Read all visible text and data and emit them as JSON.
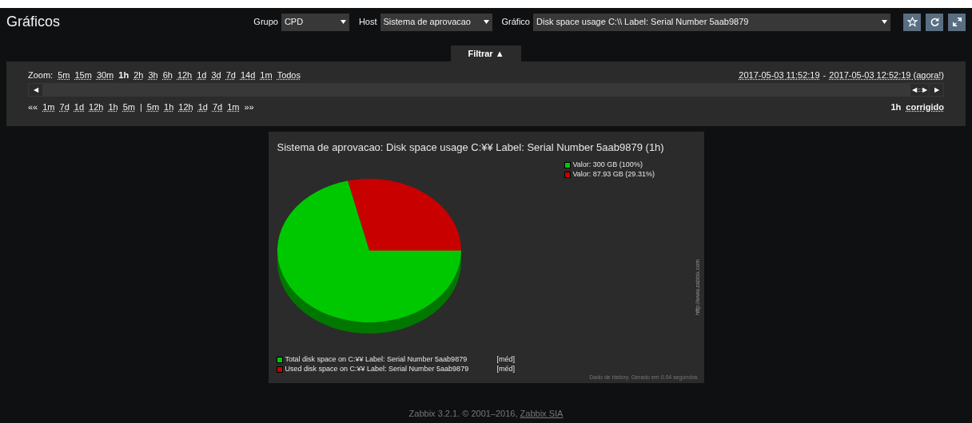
{
  "header": {
    "title": "Gráficos",
    "filters": [
      {
        "label": "Grupo",
        "value": "CPD"
      },
      {
        "label": "Host",
        "value": "Sistema de aprovacao"
      },
      {
        "label": "Gráfico",
        "value": "Disk space usage C:\\\\ Label: Serial Number 5aab9879"
      }
    ]
  },
  "filter_tab": {
    "label": "Filtrar ▲",
    "expanded": true
  },
  "zoom": {
    "label": "Zoom:",
    "options": [
      {
        "label": "5m",
        "selected": false
      },
      {
        "label": "15m",
        "selected": false
      },
      {
        "label": "30m",
        "selected": false
      },
      {
        "label": "1h",
        "selected": true
      },
      {
        "label": "2h",
        "selected": false
      },
      {
        "label": "3h",
        "selected": false
      },
      {
        "label": "6h",
        "selected": false
      },
      {
        "label": "12h",
        "selected": false
      },
      {
        "label": "1d",
        "selected": false
      },
      {
        "label": "3d",
        "selected": false
      },
      {
        "label": "7d",
        "selected": false
      },
      {
        "label": "14d",
        "selected": false
      },
      {
        "label": "1m",
        "selected": false
      },
      {
        "label": "Todos",
        "selected": false
      }
    ]
  },
  "period": {
    "from": "2017-05-03 11:52:19",
    "separator": "-",
    "to": "2017-05-03 12:52:19 (agora!)"
  },
  "scroll": {
    "left": "◀",
    "handle": "◀:::▶",
    "right": "▶"
  },
  "navigation": [
    {
      "kind": "text",
      "label": "««"
    },
    {
      "kind": "link",
      "label": "1m"
    },
    {
      "kind": "link",
      "label": "7d"
    },
    {
      "kind": "link",
      "label": "1d"
    },
    {
      "kind": "link",
      "label": "12h"
    },
    {
      "kind": "link",
      "label": "1h"
    },
    {
      "kind": "link",
      "label": "5m"
    },
    {
      "kind": "text",
      "label": "|"
    },
    {
      "kind": "link",
      "label": "5m"
    },
    {
      "kind": "link",
      "label": "1h"
    },
    {
      "kind": "link",
      "label": "12h"
    },
    {
      "kind": "link",
      "label": "1d"
    },
    {
      "kind": "link",
      "label": "7d"
    },
    {
      "kind": "link",
      "label": "1m"
    },
    {
      "kind": "text",
      "label": "»»"
    }
  ],
  "period_mode": {
    "length": "1h",
    "mode": "corrigido"
  },
  "graph": {
    "title": "Sistema de aprovacao: Disk space usage C:¥¥ Label:  Serial Number 5aab9879 (1h)",
    "pie_legend": [
      {
        "label": "Valor: 300 GB (100%)",
        "color": "#00c800"
      },
      {
        "label": "Valor: 87.93 GB (29.31%)",
        "color": "#c80000"
      }
    ],
    "items": [
      {
        "label": "Total disk space on C:¥¥ Label:  Serial Number 5aab9879",
        "function": "[méd]",
        "color": "#00c800"
      },
      {
        "label": "Used disk space on C:¥¥ Label:  Serial Number 5aab9879",
        "function": "[méd]",
        "color": "#c80000"
      }
    ],
    "watermark": "http://www.zabbix.com",
    "note": "Dado de history. Gerado em 0.04 segundos."
  },
  "footer": {
    "text": "Zabbix 3.2.1. © 2001–2016, ",
    "link": "Zabbix SIA"
  }
}
